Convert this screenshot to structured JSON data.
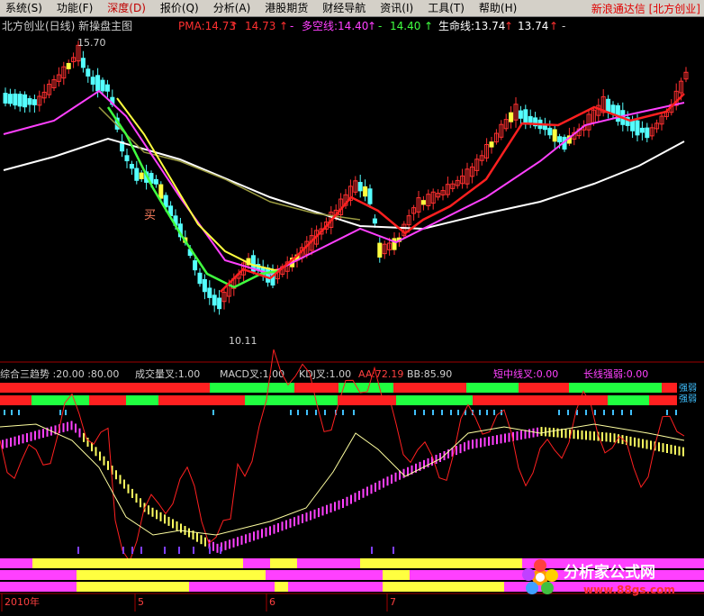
{
  "menu": {
    "items": [
      {
        "label": "系统(S)",
        "highlight": false
      },
      {
        "label": "功能(F)",
        "highlight": false
      },
      {
        "label": "深度(D)",
        "highlight": true
      },
      {
        "label": "报价(Q)",
        "highlight": false
      },
      {
        "label": "分析(A)",
        "highlight": false
      },
      {
        "label": "港股期货",
        "highlight": false
      },
      {
        "label": "财经导航",
        "highlight": false
      },
      {
        "label": "资讯(I)",
        "highlight": false
      },
      {
        "label": "工具(T)",
        "highlight": false
      },
      {
        "label": "帮助(H)",
        "highlight": false
      }
    ],
    "brand": "新浪通达信 [北方创业]"
  },
  "main_panel": {
    "title": "北方创业(日线) 新操盘主图",
    "pma_label": "PMA:14.73",
    "pma_val2": "14.73",
    "duokong_label": "多空线:14.40",
    "duokong_val2": "14.40",
    "shengming_label": "生命线:13.74",
    "shengming_val2": "13.74",
    "high_label": "15.70",
    "low_label": "10.11",
    "buy_label": "买",
    "arrow_up": "↑",
    "dash": "-"
  },
  "sub_panel": {
    "header": [
      {
        "text": "综合三趋势 :20.00 :80.00",
        "color": "#d0d0d0"
      },
      {
        "text": "成交量叉:1.00",
        "color": "#d0d0d0"
      },
      {
        "text": "MACD叉:1.00",
        "color": "#d0d0d0"
      },
      {
        "text": "KDJ叉:1.00",
        "color": "#d0d0d0"
      },
      {
        "text": "AA:72.19",
        "color": "#ff4040"
      },
      {
        "text": "BB:85.90",
        "color": "#d0d0d0"
      },
      {
        "text": "短中线叉:0.00",
        "color": "#ff40ff"
      },
      {
        "text": "长线强弱:0.00",
        "color": "#ff40ff"
      }
    ],
    "right_tags": [
      "强弱",
      "强弱"
    ]
  },
  "xaxis": {
    "labels": [
      "2010年",
      "5",
      "6",
      "7"
    ]
  },
  "watermark": {
    "text": "分析家公式网",
    "url": "www.88gs.com"
  },
  "colors": {
    "up": "#ff3030",
    "down": "#54ffff",
    "pma": "#ff2020",
    "duokong": "#ff40ff",
    "shengming": "#ffffff",
    "ma_yellow": "#ffff40",
    "ma_green": "#40ff40"
  }
}
